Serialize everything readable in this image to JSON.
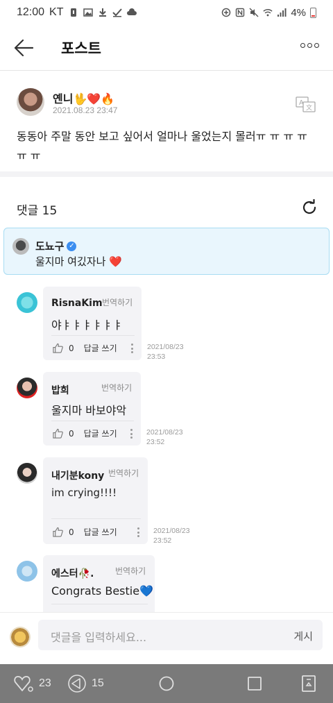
{
  "status_bar": {
    "time": "12:00",
    "carrier": "KT",
    "battery": "4%"
  },
  "header": {
    "title": "포스트",
    "back_icon": "arrow-left-icon",
    "more_icon": "more-dots-icon"
  },
  "post": {
    "author": "옌니🖖❤️🔥",
    "date": "2021.08.23 23:47",
    "body": "동동아 주말 동안 보고 싶어서 얼마나 울었는지 몰러ㅠ ㅠ ㅠ ㅠ ㅠ ㅠ",
    "translate_icon": "translate-icon"
  },
  "comments": {
    "header_label": "댓글 15",
    "refresh_icon": "refresh-icon",
    "highlighted": {
      "author": "도뇨구",
      "verified": true,
      "text": "울지마 여깄자나 ❤️"
    },
    "items": [
      {
        "author": "RisnaKim",
        "translate": "번역하기",
        "text": "야ㅑㅑㅑㅑㅑㅑ",
        "likes": "0",
        "reply": "답글 쓰기",
        "date": "2021/08/23",
        "time": "23:53"
      },
      {
        "author": "밥희",
        "translate": "번역하기",
        "text": "울지마 바보야악",
        "likes": "0",
        "reply": "답글 쓰기",
        "date": "2021/08/23",
        "time": "23:52"
      },
      {
        "author": "내기분kony",
        "translate": "번역하기",
        "text": "im crying!!!!",
        "likes": "0",
        "reply": "답글 쓰기",
        "date": "2021/08/23",
        "time": "23:52"
      },
      {
        "author": "에스터🥀.",
        "translate": "번역하기",
        "text": "Congrats Bestie💙"
      }
    ]
  },
  "input": {
    "placeholder": "댓글을 입력하세요...",
    "post_button": "게시"
  },
  "bottom_nav": {
    "likes": "23",
    "shares": "15"
  },
  "colors": {
    "highlight_bg": "#e9f6fd",
    "highlight_border": "#a7dcf3",
    "verified": "#3b8ef0",
    "nav_bg": "#7a7a7a"
  }
}
